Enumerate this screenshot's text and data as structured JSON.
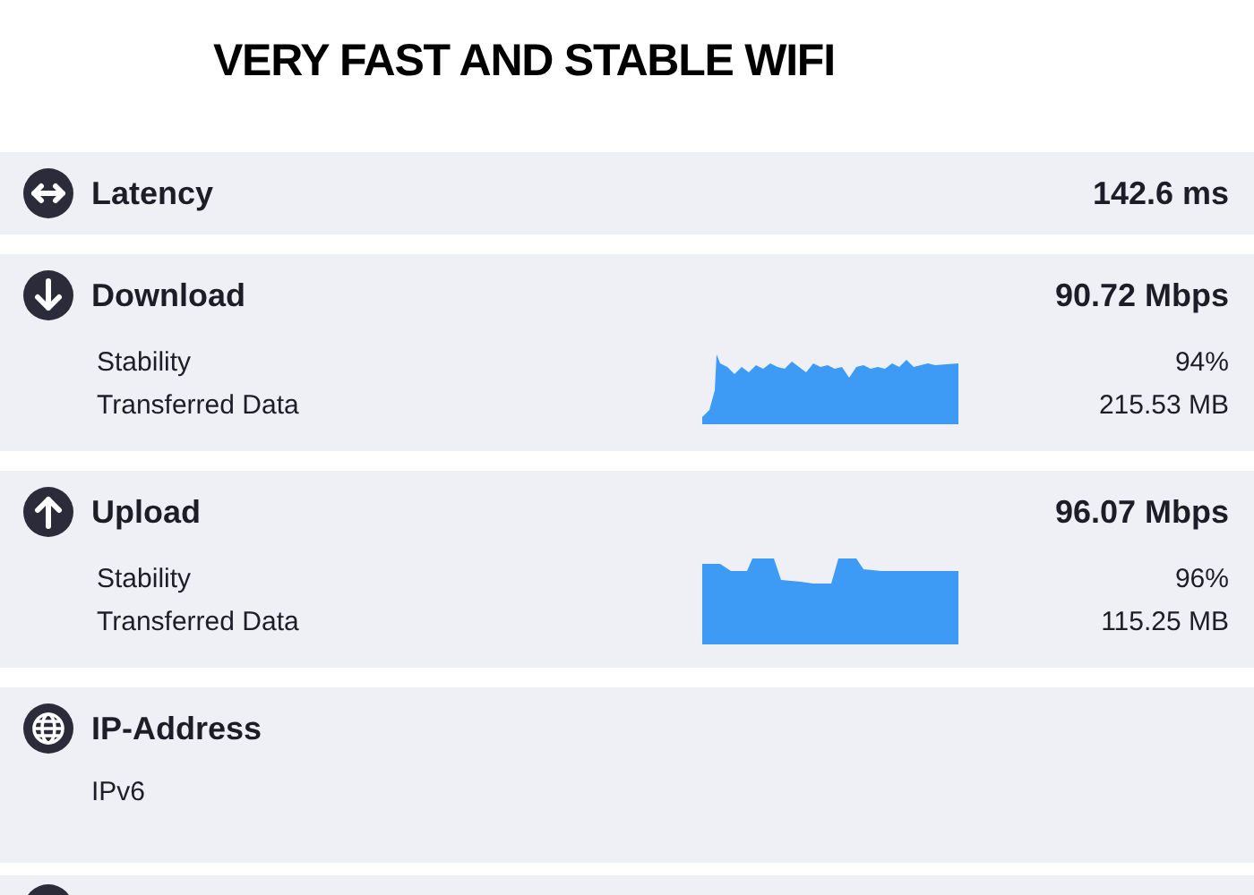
{
  "heading": "VERY FAST AND STABLE WIFI",
  "sections": [
    {
      "kind": "metric",
      "title": "Latency",
      "value": "142.6 ms"
    },
    {
      "kind": "transfer",
      "title": "Download",
      "value": "90.72 Mbps",
      "stats": [
        {
          "label": "Stability",
          "value": "94%"
        },
        {
          "label": "Transferred Data",
          "value": "215.53 MB"
        }
      ]
    },
    {
      "kind": "transfer",
      "title": "Upload",
      "value": "96.07 Mbps",
      "stats": [
        {
          "label": "Stability",
          "value": "96%"
        },
        {
          "label": "Transferred Data",
          "value": "115.25 MB"
        }
      ]
    },
    {
      "kind": "info",
      "title": "IP-Address",
      "detail": "IPv6"
    },
    {
      "kind": "cut"
    }
  ]
}
